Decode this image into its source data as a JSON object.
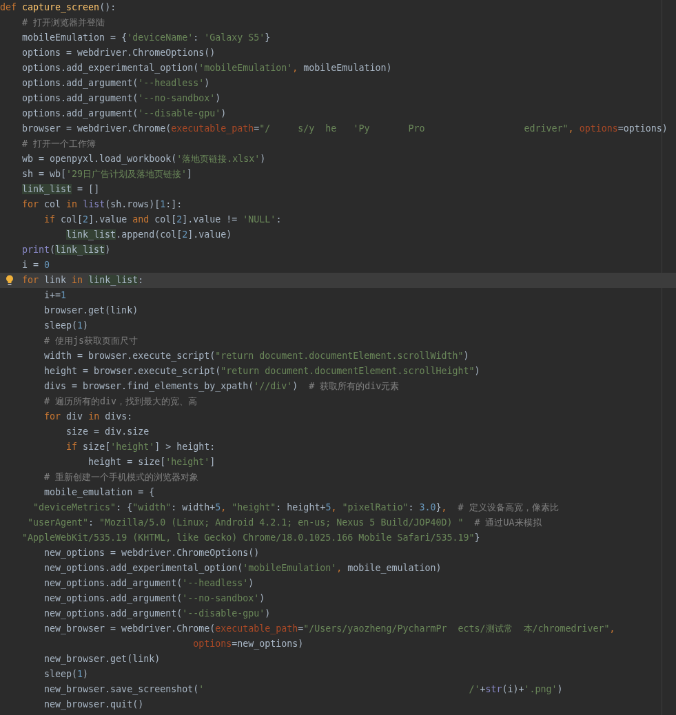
{
  "editor": {
    "lines": [
      {
        "current": false,
        "hint": false,
        "tokens": [
          {
            "kind": "kw",
            "text": "def"
          },
          {
            "kind": "fn",
            "text": " capture_screen"
          },
          {
            "kind": "plain",
            "text": "():"
          }
        ]
      },
      {
        "current": false,
        "hint": false,
        "tokens": [
          {
            "kind": "cmt",
            "text": "    # 打开浏览器并登陆"
          }
        ]
      },
      {
        "current": false,
        "hint": false,
        "tokens": [
          {
            "kind": "plain",
            "text": "    mobileEmulation = {"
          },
          {
            "kind": "str",
            "text": "'deviceName'"
          },
          {
            "kind": "plain",
            "text": ": "
          },
          {
            "kind": "str",
            "text": "'Galaxy S5'"
          },
          {
            "kind": "plain",
            "text": "}"
          }
        ]
      },
      {
        "current": false,
        "hint": false,
        "tokens": [
          {
            "kind": "plain",
            "text": "    options = webdriver.ChromeOptions()"
          }
        ]
      },
      {
        "current": false,
        "hint": false,
        "tokens": [
          {
            "kind": "plain",
            "text": "    options.add_experimental_option("
          },
          {
            "kind": "str",
            "text": "'mobileEmulation'"
          },
          {
            "kind": "kw",
            "text": ", "
          },
          {
            "kind": "plain",
            "text": "mobileEmulation)"
          }
        ]
      },
      {
        "current": false,
        "hint": false,
        "tokens": [
          {
            "kind": "plain",
            "text": "    options.add_argument("
          },
          {
            "kind": "str",
            "text": "'--headless'"
          },
          {
            "kind": "plain",
            "text": ")"
          }
        ]
      },
      {
        "current": false,
        "hint": false,
        "tokens": [
          {
            "kind": "plain",
            "text": "    options.add_argument("
          },
          {
            "kind": "str",
            "text": "'--no-sandbox'"
          },
          {
            "kind": "plain",
            "text": ")"
          }
        ]
      },
      {
        "current": false,
        "hint": false,
        "tokens": [
          {
            "kind": "plain",
            "text": "    options.add_argument("
          },
          {
            "kind": "str",
            "text": "'--disable-gpu'"
          },
          {
            "kind": "plain",
            "text": ")"
          }
        ]
      },
      {
        "current": false,
        "hint": false,
        "tokens": [
          {
            "kind": "plain",
            "text": "    browser = webdriver.Chrome("
          },
          {
            "kind": "param",
            "text": "executable_path"
          },
          {
            "kind": "plain",
            "text": "="
          },
          {
            "kind": "str",
            "text": "\"/     s/y  he   'Py       Pro                  edriver\""
          },
          {
            "kind": "kw",
            "text": ", "
          },
          {
            "kind": "param",
            "text": "options"
          },
          {
            "kind": "plain",
            "text": "=options)"
          }
        ]
      },
      {
        "current": false,
        "hint": false,
        "tokens": [
          {
            "kind": "cmt",
            "text": "    # 打开一个工作簿"
          }
        ]
      },
      {
        "current": false,
        "hint": false,
        "tokens": [
          {
            "kind": "plain",
            "text": "    wb = openpyxl.load_workbook("
          },
          {
            "kind": "str",
            "text": "'落地页链接.xlsx'"
          },
          {
            "kind": "plain",
            "text": ")"
          }
        ]
      },
      {
        "current": false,
        "hint": false,
        "tokens": [
          {
            "kind": "plain",
            "text": "    sh = wb["
          },
          {
            "kind": "str",
            "text": "'29日广告计划及落地页链接'"
          },
          {
            "kind": "plain",
            "text": "]"
          }
        ]
      },
      {
        "current": false,
        "hint": false,
        "tokens": [
          {
            "kind": "usage",
            "text": "    link_list"
          },
          {
            "kind": "plain",
            "text": " = []"
          }
        ]
      },
      {
        "current": false,
        "hint": false,
        "tokens": [
          {
            "kind": "kw",
            "text": "    for"
          },
          {
            "kind": "plain",
            "text": " col "
          },
          {
            "kind": "kw",
            "text": "in"
          },
          {
            "kind": "builtin",
            "text": " list"
          },
          {
            "kind": "plain",
            "text": "(sh.rows)["
          },
          {
            "kind": "num",
            "text": "1"
          },
          {
            "kind": "plain",
            "text": ":]:"
          }
        ]
      },
      {
        "current": false,
        "hint": false,
        "tokens": [
          {
            "kind": "kw",
            "text": "        if"
          },
          {
            "kind": "plain",
            "text": " col["
          },
          {
            "kind": "num",
            "text": "2"
          },
          {
            "kind": "plain",
            "text": "].value "
          },
          {
            "kind": "kw",
            "text": "and"
          },
          {
            "kind": "plain",
            "text": " col["
          },
          {
            "kind": "num",
            "text": "2"
          },
          {
            "kind": "plain",
            "text": "].value != "
          },
          {
            "kind": "str",
            "text": "'NULL'"
          },
          {
            "kind": "plain",
            "text": ":"
          }
        ]
      },
      {
        "current": false,
        "hint": false,
        "tokens": [
          {
            "kind": "usage",
            "text": "            link_list"
          },
          {
            "kind": "plain",
            "text": ".append(col["
          },
          {
            "kind": "num",
            "text": "2"
          },
          {
            "kind": "plain",
            "text": "].value)"
          }
        ]
      },
      {
        "current": false,
        "hint": false,
        "tokens": [
          {
            "kind": "builtin",
            "text": "    print"
          },
          {
            "kind": "plain",
            "text": "("
          },
          {
            "kind": "usage",
            "text": "link_list"
          },
          {
            "kind": "plain",
            "text": ")"
          }
        ]
      },
      {
        "current": false,
        "hint": false,
        "tokens": [
          {
            "kind": "plain",
            "text": "    i = "
          },
          {
            "kind": "num",
            "text": "0"
          }
        ]
      },
      {
        "current": true,
        "hint": true,
        "tokens": [
          {
            "kind": "kw",
            "text": "    for"
          },
          {
            "kind": "plain",
            "text": " link "
          },
          {
            "kind": "kw",
            "text": "in"
          },
          {
            "kind": "usage",
            "text": " link_list"
          },
          {
            "kind": "plain",
            "text": ":"
          }
        ]
      },
      {
        "current": false,
        "hint": false,
        "tokens": [
          {
            "kind": "plain",
            "text": "        i+="
          },
          {
            "kind": "num",
            "text": "1"
          }
        ]
      },
      {
        "current": false,
        "hint": false,
        "tokens": [
          {
            "kind": "plain",
            "text": "        browser.get(link)"
          }
        ]
      },
      {
        "current": false,
        "hint": false,
        "tokens": [
          {
            "kind": "plain",
            "text": "        sleep("
          },
          {
            "kind": "num",
            "text": "1"
          },
          {
            "kind": "plain",
            "text": ")"
          }
        ]
      },
      {
        "current": false,
        "hint": false,
        "tokens": [
          {
            "kind": "cmt",
            "text": "        # 使用js获取页面尺寸"
          }
        ]
      },
      {
        "current": false,
        "hint": false,
        "tokens": [
          {
            "kind": "plain",
            "text": "        width = browser.execute_script("
          },
          {
            "kind": "str",
            "text": "\"return document.documentElement.scrollWidth\""
          },
          {
            "kind": "plain",
            "text": ")"
          }
        ]
      },
      {
        "current": false,
        "hint": false,
        "tokens": [
          {
            "kind": "plain",
            "text": "        height = browser.execute_script("
          },
          {
            "kind": "str",
            "text": "\"return document.documentElement.scrollHeight\""
          },
          {
            "kind": "plain",
            "text": ")"
          }
        ]
      },
      {
        "current": false,
        "hint": false,
        "tokens": [
          {
            "kind": "plain",
            "text": "        divs = browser.find_elements_by_xpath("
          },
          {
            "kind": "str",
            "text": "'//div'"
          },
          {
            "kind": "plain",
            "text": ")"
          },
          {
            "kind": "cmt",
            "text": "  # 获取所有的div元素"
          }
        ]
      },
      {
        "current": false,
        "hint": false,
        "tokens": [
          {
            "kind": "cmt",
            "text": "        # 遍历所有的div，找到最大的宽、高"
          }
        ]
      },
      {
        "current": false,
        "hint": false,
        "tokens": [
          {
            "kind": "kw",
            "text": "        for"
          },
          {
            "kind": "plain",
            "text": " div "
          },
          {
            "kind": "kw",
            "text": "in"
          },
          {
            "kind": "plain",
            "text": " divs:"
          }
        ]
      },
      {
        "current": false,
        "hint": false,
        "tokens": [
          {
            "kind": "plain",
            "text": "            size = div.size"
          }
        ]
      },
      {
        "current": false,
        "hint": false,
        "tokens": [
          {
            "kind": "kw",
            "text": "            if"
          },
          {
            "kind": "plain",
            "text": " size["
          },
          {
            "kind": "str",
            "text": "'height'"
          },
          {
            "kind": "plain",
            "text": "] > height:"
          }
        ]
      },
      {
        "current": false,
        "hint": false,
        "tokens": [
          {
            "kind": "plain",
            "text": "                height = size["
          },
          {
            "kind": "str",
            "text": "'height'"
          },
          {
            "kind": "plain",
            "text": "]"
          }
        ]
      },
      {
        "current": false,
        "hint": false,
        "tokens": [
          {
            "kind": "cmt",
            "text": "        # 重新创建一个手机模式的浏览器对象"
          }
        ]
      },
      {
        "current": false,
        "hint": false,
        "tokens": [
          {
            "kind": "plain",
            "text": "        mobile_emulation = {"
          }
        ]
      },
      {
        "current": false,
        "hint": false,
        "tokens": [
          {
            "kind": "str",
            "text": "      \"deviceMetrics\""
          },
          {
            "kind": "plain",
            "text": ": {"
          },
          {
            "kind": "str",
            "text": "\"width\""
          },
          {
            "kind": "plain",
            "text": ": width+"
          },
          {
            "kind": "num",
            "text": "5"
          },
          {
            "kind": "kw",
            "text": ", "
          },
          {
            "kind": "str",
            "text": "\"height\""
          },
          {
            "kind": "plain",
            "text": ": height+"
          },
          {
            "kind": "num",
            "text": "5"
          },
          {
            "kind": "kw",
            "text": ", "
          },
          {
            "kind": "str",
            "text": "\"pixelRatio\""
          },
          {
            "kind": "plain",
            "text": ": "
          },
          {
            "kind": "num",
            "text": "3.0"
          },
          {
            "kind": "plain",
            "text": "}"
          },
          {
            "kind": "kw",
            "text": ",  "
          },
          {
            "kind": "cmt",
            "text": "# 定义设备高宽，像素比"
          }
        ]
      },
      {
        "current": false,
        "hint": false,
        "tokens": [
          {
            "kind": "str",
            "text": "     \"userAgent\""
          },
          {
            "kind": "plain",
            "text": ": "
          },
          {
            "kind": "str",
            "text": "\"Mozilla/5.0 (Linux; Android 4.2.1; en-us; Nexus 5 Build/JOP40D) \""
          },
          {
            "kind": "cmt",
            "text": "  # 通过UA来模拟"
          }
        ]
      },
      {
        "current": false,
        "hint": false,
        "tokens": [
          {
            "kind": "str",
            "text": "    \"AppleWebKit/535.19 (KHTML, like Gecko) Chrome/18.0.1025.166 Mobile Safari/535.19\""
          },
          {
            "kind": "plain",
            "text": "}"
          }
        ]
      },
      {
        "current": false,
        "hint": false,
        "tokens": [
          {
            "kind": "plain",
            "text": "        new_options = webdriver.ChromeOptions()"
          }
        ]
      },
      {
        "current": false,
        "hint": false,
        "tokens": [
          {
            "kind": "plain",
            "text": "        new_options.add_experimental_option("
          },
          {
            "kind": "str",
            "text": "'mobileEmulation'"
          },
          {
            "kind": "kw",
            "text": ", "
          },
          {
            "kind": "plain",
            "text": "mobile_emulation)"
          }
        ]
      },
      {
        "current": false,
        "hint": false,
        "tokens": [
          {
            "kind": "plain",
            "text": "        new_options.add_argument("
          },
          {
            "kind": "str",
            "text": "'--headless'"
          },
          {
            "kind": "plain",
            "text": ")"
          }
        ]
      },
      {
        "current": false,
        "hint": false,
        "tokens": [
          {
            "kind": "plain",
            "text": "        new_options.add_argument("
          },
          {
            "kind": "str",
            "text": "'--no-sandbox'"
          },
          {
            "kind": "plain",
            "text": ")"
          }
        ]
      },
      {
        "current": false,
        "hint": false,
        "tokens": [
          {
            "kind": "plain",
            "text": "        new_options.add_argument("
          },
          {
            "kind": "str",
            "text": "'--disable-gpu'"
          },
          {
            "kind": "plain",
            "text": ")"
          }
        ]
      },
      {
        "current": false,
        "hint": false,
        "tokens": [
          {
            "kind": "plain",
            "text": "        new_browser = webdriver.Chrome("
          },
          {
            "kind": "param",
            "text": "executable_path"
          },
          {
            "kind": "plain",
            "text": "="
          },
          {
            "kind": "str",
            "text": "\"/Users/yaozheng/PycharmPr  ects/测试常  本/chromedriver\""
          },
          {
            "kind": "kw",
            "text": ","
          }
        ]
      },
      {
        "current": false,
        "hint": false,
        "tokens": [
          {
            "kind": "param",
            "text": "                                   options"
          },
          {
            "kind": "plain",
            "text": "=new_options)"
          }
        ]
      },
      {
        "current": false,
        "hint": false,
        "tokens": [
          {
            "kind": "plain",
            "text": "        new_browser.get(link)"
          }
        ]
      },
      {
        "current": false,
        "hint": false,
        "tokens": [
          {
            "kind": "plain",
            "text": "        sleep("
          },
          {
            "kind": "num",
            "text": "1"
          },
          {
            "kind": "plain",
            "text": ")"
          }
        ]
      },
      {
        "current": false,
        "hint": false,
        "tokens": [
          {
            "kind": "plain",
            "text": "        new_browser.save_screenshot("
          },
          {
            "kind": "str",
            "text": "'                                                /'"
          },
          {
            "kind": "plain",
            "text": "+"
          },
          {
            "kind": "builtin",
            "text": "str"
          },
          {
            "kind": "plain",
            "text": "(i)+"
          },
          {
            "kind": "str",
            "text": "'.png'"
          },
          {
            "kind": "plain",
            "text": ")"
          }
        ]
      },
      {
        "current": false,
        "hint": false,
        "tokens": [
          {
            "kind": "plain",
            "text": "        new_browser.quit()"
          }
        ]
      }
    ]
  }
}
